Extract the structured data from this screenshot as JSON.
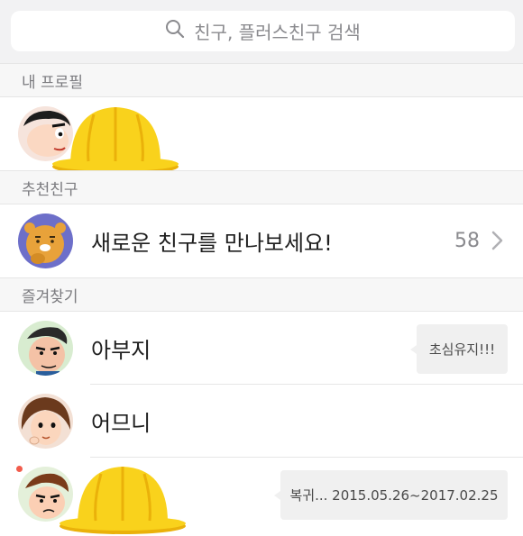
{
  "search": {
    "placeholder": "친구, 플러스친구 검색",
    "icon": "search-icon"
  },
  "sections": {
    "my_profile": "내 프로필",
    "recommended": "추천친구",
    "favorites": "즐겨찾기"
  },
  "recommended_row": {
    "title": "새로운 친구를 만나보세요!",
    "count": "58"
  },
  "favorites": [
    {
      "name": "아부지",
      "status": "초심유지!!!"
    },
    {
      "name": "어므니",
      "status": ""
    },
    {
      "name": "",
      "status": "복귀... 2015.05.26~2017.02.25",
      "new_badge": true
    }
  ],
  "colors": {
    "hat_yellow": "#f9d21c",
    "hat_shadow": "#eab10a",
    "badge_red": "#f25c4c",
    "ryan_purple": "#6d6fc9"
  }
}
